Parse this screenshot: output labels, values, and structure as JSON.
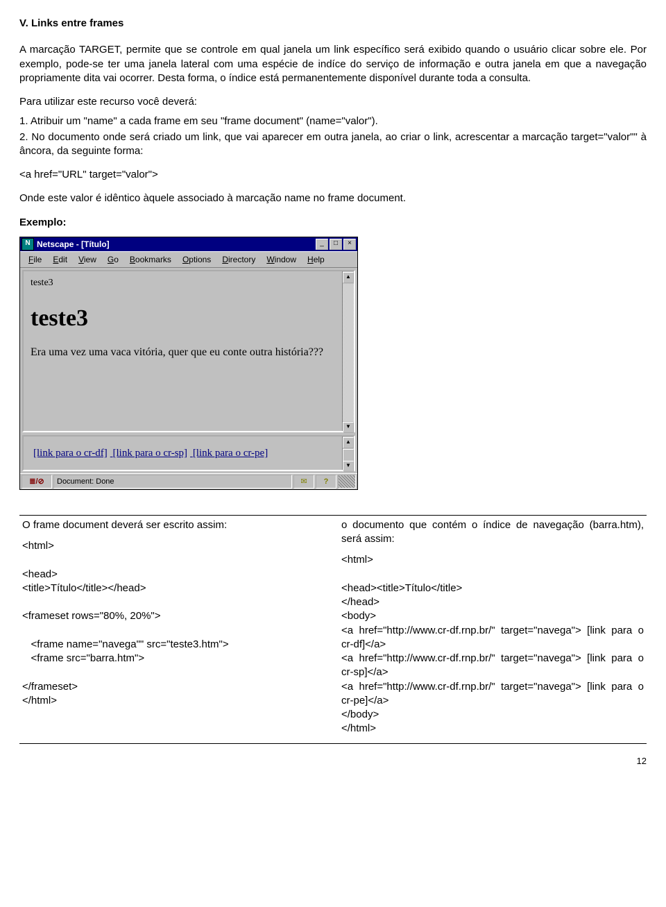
{
  "section": {
    "title": "V. Links entre frames",
    "p1": "A marcação TARGET, permite que se controle em qual janela um link específico será exibido quando o usuário clicar sobre ele. Por exemplo, pode-se ter uma janela lateral com uma espécie de indíce do serviço de informação e outra janela em que a navegação propriamente dita vai ocorrer. Desta forma, o índice está permanentemente disponível durante toda a consulta.",
    "intro": "Para utilizar este recurso você deverá:",
    "li1": "1. Atribuir um \"name\" a cada frame em seu \"frame document\" (name=\"valor\").",
    "li2": "2. No documento onde será criado um link, que vai aparecer em outra janela, ao criar o link, acrescentar a marcação target=\"valor\"\" à âncora, da seguinte forma:",
    "anchor": "<a href=\"URL\" target=\"valor\">",
    "onde": "Onde este valor é idêntico àquele associado à marcação name no frame document.",
    "exemplo": "Exemplo:"
  },
  "win": {
    "title": "Netscape - [Título]",
    "min": "_",
    "max": "□",
    "close": "×",
    "menu": {
      "file": "File",
      "edit": "Edit",
      "view": "View",
      "go": "Go",
      "bookmarks": "Bookmarks",
      "options": "Options",
      "directory": "Directory",
      "window": "Window",
      "help": "Help"
    },
    "frame": {
      "label": "teste3",
      "big": "teste3",
      "body": "Era uma vez uma vaca vitória, quer que eu conte outra história???",
      "link1": "[link para o cr-df]",
      "link2": "[link para o cr-sp]",
      "link3": "[link para o cr-pe]"
    },
    "status": {
      "icon": "≣/⊘",
      "text": "Document: Done",
      "mail": "✉",
      "q": "?"
    },
    "scroll": {
      "up": "▲",
      "down": "▼"
    }
  },
  "cols": {
    "left": {
      "header": "O frame document deverá ser escrito assim:",
      "code": "<html>\n\n<head>\n<title>Título</title></head>\n\n<frameset rows=\"80%, 20%\">\n\n   <frame name=\"navega\"\" src=\"teste3.htm\">\n   <frame src=\"barra.htm\">\n\n</frameset>\n</html>"
    },
    "right": {
      "header": "o documento que contém o índice de navegação (barra.htm), será assim:",
      "code": "<html>\n\n<head><title>Título</title>\n</head>\n<body>\n<a href=\"http://www.cr-df.rnp.br/\" target=\"navega\"> [link para o cr-df]</a>\n<a href=\"http://www.cr-df.rnp.br/\" target=\"navega\"> [link para o cr-sp]</a>\n<a href=\"http://www.cr-df.rnp.br/\" target=\"navega\"> [link para o cr-pe]</a>\n</body>\n</html>"
    }
  },
  "page": "12"
}
